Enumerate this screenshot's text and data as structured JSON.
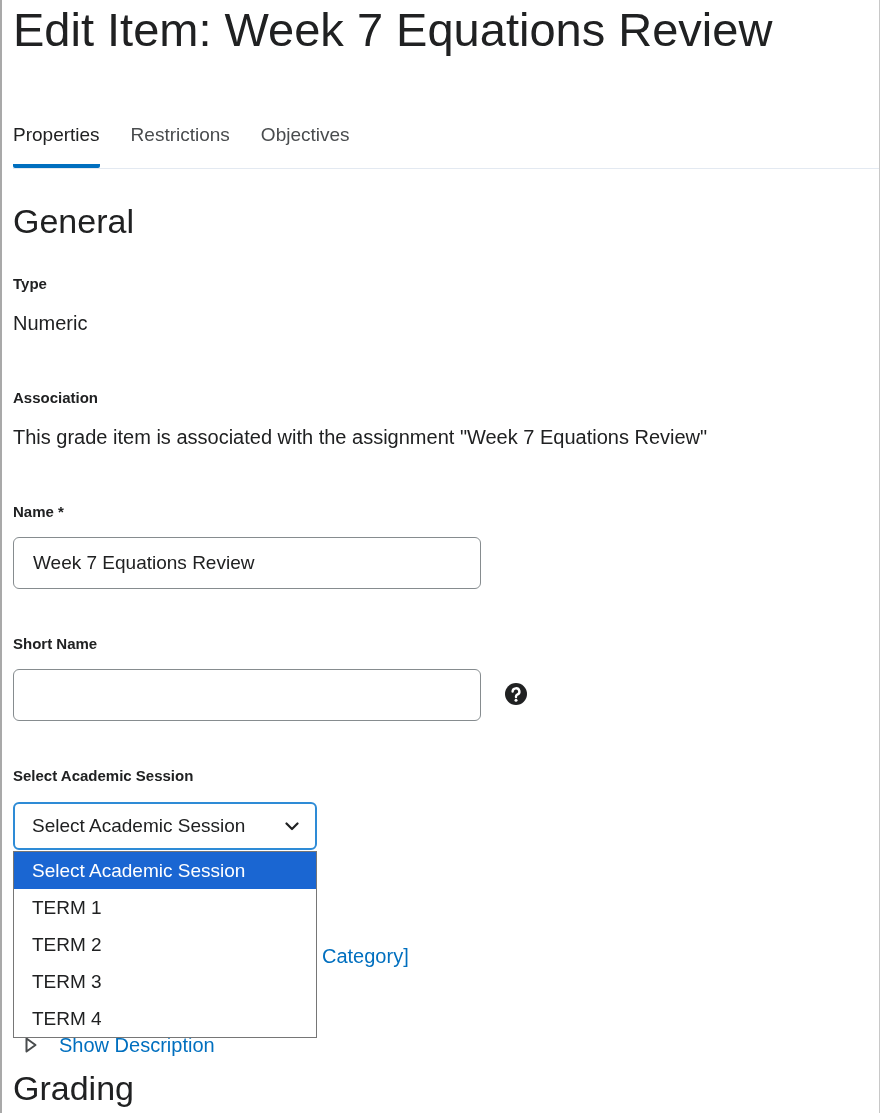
{
  "page_title": "Edit Item: Week 7 Equations Review",
  "tabs": [
    {
      "label": "Properties",
      "selected": true
    },
    {
      "label": "Restrictions",
      "selected": false
    },
    {
      "label": "Objectives",
      "selected": false
    }
  ],
  "section_title": "General",
  "fields": [
    {
      "kind": "static",
      "label": "Type",
      "value": "Numeric"
    },
    {
      "kind": "static",
      "label": "Association",
      "value": "This grade item is associated with the assignment \"Week 7 Equations Review\""
    },
    {
      "kind": "text",
      "label": "Name *",
      "value": "Week 7 Equations Review"
    },
    {
      "kind": "text",
      "label": "Short Name",
      "help": true
    },
    {
      "kind": "select",
      "label": "Select Academic Session",
      "value": "Select Academic Session",
      "expanded": true,
      "options": [
        {
          "label": "Select Academic Session",
          "selected": true
        },
        {
          "label": "TERM 1",
          "selected": false
        },
        {
          "label": "TERM 2",
          "selected": false
        },
        {
          "label": "TERM 3",
          "selected": false
        },
        {
          "label": "TERM 4",
          "selected": false
        }
      ]
    }
  ],
  "category_link": "Category]",
  "show_description": "Show Description",
  "next_section_title": "Grading"
}
